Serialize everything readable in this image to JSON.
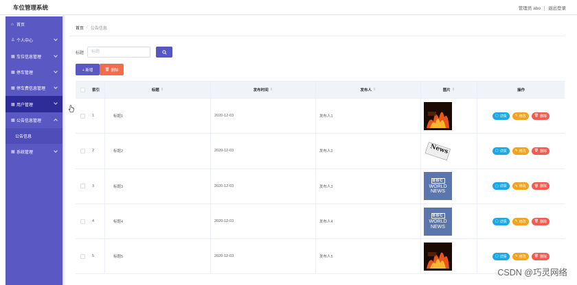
{
  "app": {
    "title": "车位管理系统"
  },
  "topbar": {
    "user_label": "管理员 abo",
    "logout_label": "退出登录"
  },
  "sidebar": {
    "items": [
      {
        "label": "首页",
        "icon": "home-icon",
        "has_chevron": false
      },
      {
        "label": "个人中心",
        "icon": "user-icon",
        "has_chevron": true
      },
      {
        "label": "车位信息管理",
        "icon": "grid-icon",
        "has_chevron": true
      },
      {
        "label": "停车管理",
        "icon": "grid-icon",
        "has_chevron": true
      },
      {
        "label": "停车费信息管理",
        "icon": "grid-icon",
        "has_chevron": true
      },
      {
        "label": "用户管理",
        "icon": "grid-icon",
        "has_chevron": true,
        "active": true
      },
      {
        "label": "公告信息管理",
        "icon": "grid-icon",
        "has_chevron": true,
        "expanded": true
      }
    ],
    "submenu": [
      {
        "label": "公告信息"
      }
    ],
    "bottom_item": {
      "label": "系统管理",
      "icon": "grid-icon"
    }
  },
  "breadcrumb": {
    "home": "首页",
    "separator": "/",
    "current": "公告信息"
  },
  "search": {
    "label": "标题",
    "placeholder": "标题"
  },
  "actions": {
    "add_label": "+ 新增",
    "delete_label": "删除"
  },
  "table": {
    "headers": {
      "index": "索引",
      "title": "标题",
      "date": "发布时间",
      "publisher": "发布人",
      "image": "图片",
      "ops": "操作"
    },
    "rows": [
      {
        "index": "1",
        "title": "标题1",
        "date": "2020-12-03",
        "publisher": "发布人1",
        "image": "fire-news-thumbnail"
      },
      {
        "index": "2",
        "title": "标题2",
        "date": "2020-12-03",
        "publisher": "发布人2",
        "image": "news-paper-thumbnail"
      },
      {
        "index": "3",
        "title": "标题3",
        "date": "2020-12-03",
        "publisher": "发布人3",
        "image": "bbc-world-news-thumbnail"
      },
      {
        "index": "4",
        "title": "标题4",
        "date": "2020-12-03",
        "publisher": "发布人4",
        "image": "bbc-world-news-thumbnail"
      },
      {
        "index": "5",
        "title": "标题5",
        "date": "2020-12-03",
        "publisher": "发布人5",
        "image": "fire-news-thumbnail"
      }
    ],
    "op_labels": {
      "detail": "详情",
      "edit": "修改",
      "delete": "删除"
    }
  },
  "thumb_text": {
    "paper": "News",
    "bbc_logo": "BBC",
    "bbc_world": "WORLD",
    "bbc_news": "NEWS"
  },
  "watermark": "CSDN @巧灵网络",
  "colors": {
    "sidebar": "#5a59c4",
    "sidebar_active": "#2e2c99",
    "primary": "#5557c2",
    "danger": "#f36c4b",
    "detail": "#1aa8e6",
    "edit": "#f5a31a",
    "delete": "#f35b4f"
  }
}
